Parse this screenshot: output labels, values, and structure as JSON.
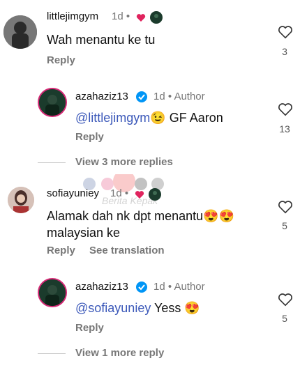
{
  "comments": [
    {
      "username": "littlejimgym",
      "time": "1d",
      "text": "Wah menantu ke tu",
      "reply_label": "Reply",
      "likes": "3"
    },
    {
      "username": "azahaziz13",
      "time": "1d",
      "author_label": "Author",
      "mention": "@littlejimgym",
      "text": " GF Aaron",
      "reply_label": "Reply",
      "likes": "13"
    },
    {
      "view_more": "View 3 more replies"
    },
    {
      "username": "sofiayuniey",
      "time": "1d",
      "text_line1": "Alamak dah nk dpt menantu",
      "text_line2": "malaysian ke",
      "reply_label": "Reply",
      "see_translation": "See translation",
      "likes": "5"
    },
    {
      "username": "azahaziz13",
      "time": "1d",
      "author_label": "Author",
      "mention": "@sofiayuniey",
      "text": " Yess ",
      "reply_label": "Reply",
      "likes": "5"
    },
    {
      "view_more": "View 1 more reply"
    }
  ],
  "watermark": "Berita Kepak",
  "colors": {
    "mention": "#3b58b9",
    "heart": "#e0245e",
    "verified": "#0095f6"
  }
}
